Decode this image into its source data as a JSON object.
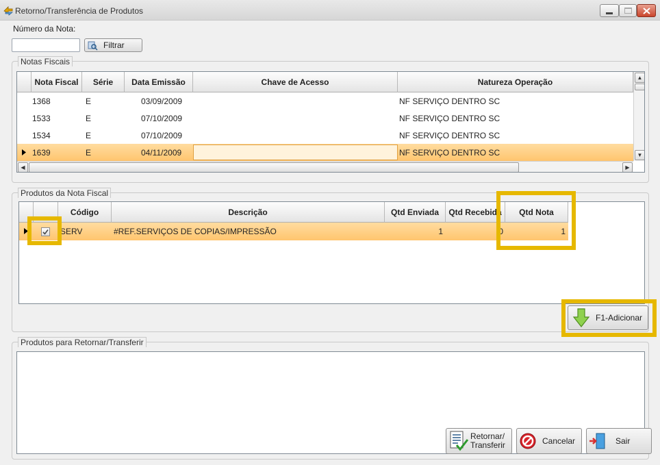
{
  "window": {
    "title": "Retorno/Transferência de Produtos"
  },
  "filter": {
    "label": "Número da Nota:",
    "value": "",
    "button_label": "Filtrar"
  },
  "notas": {
    "group_title": "Notas Fiscais",
    "columns": [
      "Nota Fiscal",
      "Série",
      "Data Emissão",
      "Chave de Acesso",
      "Natureza Operação"
    ],
    "rows": [
      {
        "nota": "1368",
        "serie": "E",
        "data": "03/09/2009",
        "chave": "",
        "natureza": "NF SERVIÇO DENTRO SC"
      },
      {
        "nota": "1533",
        "serie": "E",
        "data": "07/10/2009",
        "chave": "",
        "natureza": "NF SERVIÇO DENTRO SC"
      },
      {
        "nota": "1534",
        "serie": "E",
        "data": "07/10/2009",
        "chave": "",
        "natureza": "NF SERVIÇO DENTRO SC"
      },
      {
        "nota": "1639",
        "serie": "E",
        "data": "04/11/2009",
        "chave": "",
        "natureza": "NF SERVIÇO DENTRO SC"
      }
    ]
  },
  "produtos": {
    "group_title": "Produtos da Nota Fiscal",
    "columns": [
      "Código",
      "Descrição",
      "Qtd Enviada",
      "Qtd Recebida",
      "Qtd Nota"
    ],
    "rows": [
      {
        "checked": true,
        "codigo": "SERV",
        "descricao": "#REF.SERVIÇOS DE COPIAS/IMPRESSÃO",
        "qtd_enviada": "1",
        "qtd_recebida": "0",
        "qtd_nota": "1"
      }
    ],
    "add_button": "F1-Adicionar"
  },
  "retornar": {
    "group_title": "Produtos para Retornar/Transferir"
  },
  "actions": {
    "retornar_line1": "Retornar/",
    "retornar_line2": "Transferir",
    "cancelar": "Cancelar",
    "sair": "Sair"
  },
  "colors": {
    "highlight": "#e6b800",
    "selected_row": "#ffc56e"
  }
}
